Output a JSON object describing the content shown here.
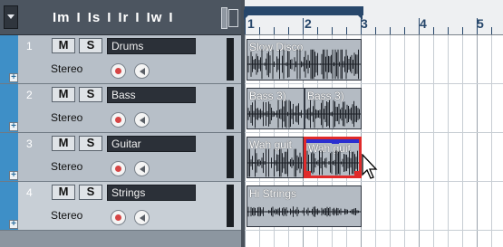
{
  "header": {
    "toggles": [
      "m",
      "s",
      "r",
      "w"
    ]
  },
  "ruler": {
    "bars": [
      "1",
      "2",
      "3",
      "4",
      "5"
    ]
  },
  "tracks": [
    {
      "number": "1",
      "name": "Drums",
      "mute_label": "M",
      "solo_label": "S",
      "channel": "Stereo",
      "selected": false
    },
    {
      "number": "2",
      "name": "Bass",
      "mute_label": "M",
      "solo_label": "S",
      "channel": "Stereo",
      "selected": false
    },
    {
      "number": "3",
      "name": "Guitar",
      "mute_label": "M",
      "solo_label": "S",
      "channel": "Stereo",
      "selected": false
    },
    {
      "number": "4",
      "name": "Strings",
      "mute_label": "M",
      "solo_label": "S",
      "channel": "Stereo",
      "selected": true
    }
  ],
  "events": [
    {
      "track": 1,
      "name": "Slow Disco"
    },
    {
      "track": 2,
      "name": "Bass 3)"
    },
    {
      "track": 2,
      "name": "Bass 3)"
    },
    {
      "track": 3,
      "name": "Wah guit"
    },
    {
      "track": 3,
      "name": "Wah guit",
      "selected": true
    },
    {
      "track": 4,
      "name": "Hi Strings"
    }
  ],
  "icons": {
    "record": "record-enable-icon",
    "monitor": "monitor-speaker-icon",
    "cursor": "mouse-pointer-icon"
  },
  "colors": {
    "track_stripe": "#3e8fc7",
    "loop_bar": "#27476b",
    "selection": "#e02a2a"
  }
}
